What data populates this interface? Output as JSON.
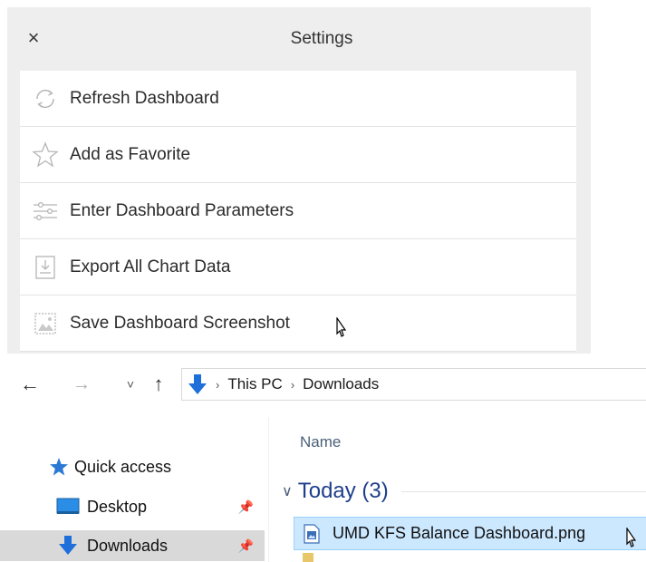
{
  "settings": {
    "title": "Settings",
    "close_glyph": "×",
    "items": [
      {
        "label": "Refresh Dashboard",
        "icon": "refresh-icon"
      },
      {
        "label": "Add as Favorite",
        "icon": "star-icon"
      },
      {
        "label": "Enter Dashboard Parameters",
        "icon": "sliders-icon"
      },
      {
        "label": "Export All Chart Data",
        "icon": "export-icon"
      },
      {
        "label": "Save Dashboard Screenshot",
        "icon": "image-icon"
      }
    ]
  },
  "explorer": {
    "nav": {
      "back": "←",
      "forward": "→",
      "recent": "˅",
      "up": "↑"
    },
    "breadcrumbs": [
      "This PC",
      "Downloads"
    ],
    "sidebar": [
      {
        "label": "Quick access",
        "icon": "star-icon"
      },
      {
        "label": "Desktop",
        "icon": "desktop-icon",
        "pinned": true
      },
      {
        "label": "Downloads",
        "icon": "download-arrow-icon",
        "pinned": true,
        "selected": true
      }
    ],
    "column_header": "Name",
    "group": {
      "label": "Today (3)"
    },
    "files": [
      {
        "name": "UMD KFS Balance Dashboard.png",
        "selected": true
      }
    ]
  },
  "colors": {
    "panel_bg": "#eeeeee",
    "selection": "#cce8ff",
    "selection_border": "#99d1ff",
    "accent_blue": "#1e6fd9",
    "group_text": "#1e3f8c"
  }
}
